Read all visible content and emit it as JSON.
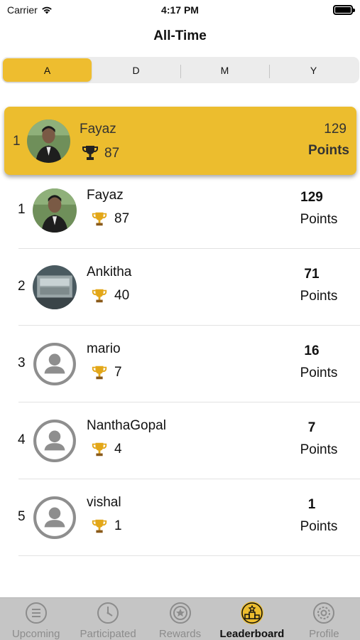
{
  "status_bar": {
    "carrier": "Carrier",
    "time": "4:17 PM"
  },
  "nav": {
    "title": "All-Time"
  },
  "segments": [
    {
      "label": "A",
      "active": true
    },
    {
      "label": "D",
      "active": false
    },
    {
      "label": "M",
      "active": false
    },
    {
      "label": "Y",
      "active": false
    }
  ],
  "my_entry": {
    "rank": "1",
    "name": "Fayaz",
    "trophies": "87",
    "points": "129",
    "points_label": "Points",
    "avatar": "photo"
  },
  "leaderboard": [
    {
      "rank": "1",
      "name": "Fayaz",
      "trophies": "87",
      "points": "129",
      "points_label": "Points",
      "avatar": "photo"
    },
    {
      "rank": "2",
      "name": "Ankitha",
      "trophies": "40",
      "points": "71",
      "points_label": "Points",
      "avatar": "photo"
    },
    {
      "rank": "3",
      "name": "mario",
      "trophies": "7",
      "points": "16",
      "points_label": "Points",
      "avatar": "placeholder"
    },
    {
      "rank": "4",
      "name": "NanthaGopal",
      "trophies": "4",
      "points": "7",
      "points_label": "Points",
      "avatar": "placeholder"
    },
    {
      "rank": "5",
      "name": "vishal",
      "trophies": "1",
      "points": "1",
      "points_label": "Points",
      "avatar": "placeholder"
    }
  ],
  "tabs": [
    {
      "label": "Upcoming",
      "icon": "list-icon",
      "active": false
    },
    {
      "label": "Participated",
      "icon": "clock-icon",
      "active": false
    },
    {
      "label": "Rewards",
      "icon": "badge-icon",
      "active": false
    },
    {
      "label": "Leaderboard",
      "icon": "podium-icon",
      "active": true
    },
    {
      "label": "Profile",
      "icon": "gear-icon",
      "active": false
    }
  ],
  "colors": {
    "accent": "#ecbd2e",
    "tab_bar": "#c5c5c5",
    "inactive_tab": "#8c8c8c"
  }
}
